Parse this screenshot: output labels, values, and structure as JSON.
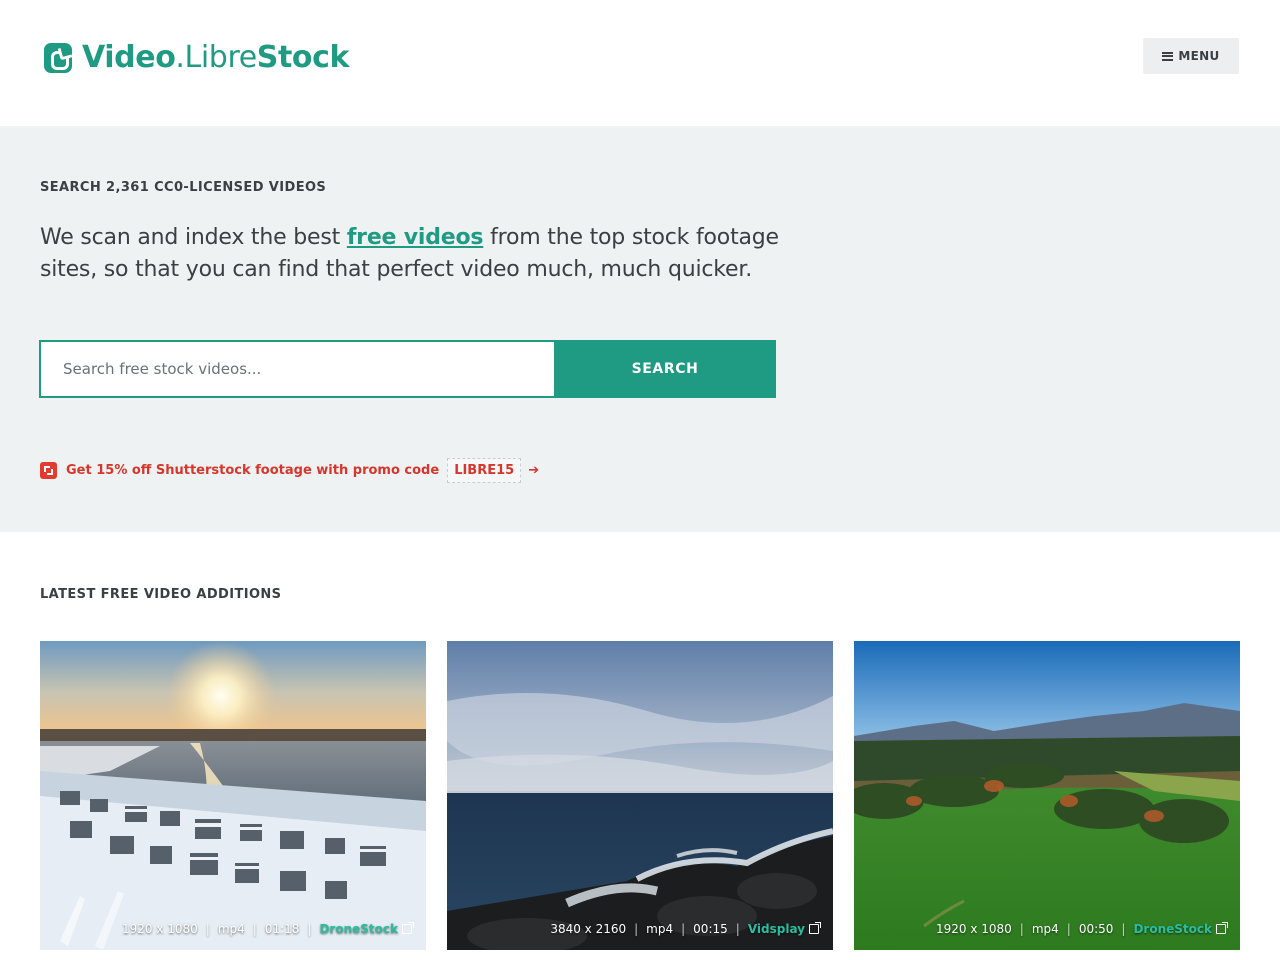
{
  "header": {
    "logo": {
      "part1": "Video",
      "dot": ".",
      "part2": "Libre",
      "part3": "Stock"
    },
    "menu_label": "MENU"
  },
  "hero": {
    "eyebrow": "SEARCH 2,361 CC0-LICENSED VIDEOS",
    "lead_before": "We scan and index the best ",
    "lead_link": "free videos",
    "lead_after": " from the top stock footage sites, so that you can find that perfect video much, much quicker.",
    "search": {
      "placeholder": "Search free stock videos...",
      "button_label": "SEARCH"
    },
    "promo": {
      "text": "Get 15% off Shutterstock footage with promo code",
      "code": "LIBRE15",
      "arrow": "➔"
    }
  },
  "latest": {
    "title": "LATEST FREE VIDEO ADDITIONS",
    "videos": [
      {
        "resolution": "1920 x 1080",
        "format": "mp4",
        "duration": "01:18",
        "source": "DroneStock",
        "scene": "snowy coastal town at sunset"
      },
      {
        "resolution": "3840 x 2160",
        "format": "mp4",
        "duration": "00:15",
        "source": "Vidsplay",
        "scene": "waves crashing on rocky shore"
      },
      {
        "resolution": "1920 x 1080",
        "format": "mp4",
        "duration": "00:50",
        "source": "DroneStock",
        "scene": "green field with forest and mountains"
      }
    ]
  },
  "colors": {
    "brand": "#209b83",
    "promo": "#d6362b",
    "hero_bg": "#eff2f3"
  }
}
